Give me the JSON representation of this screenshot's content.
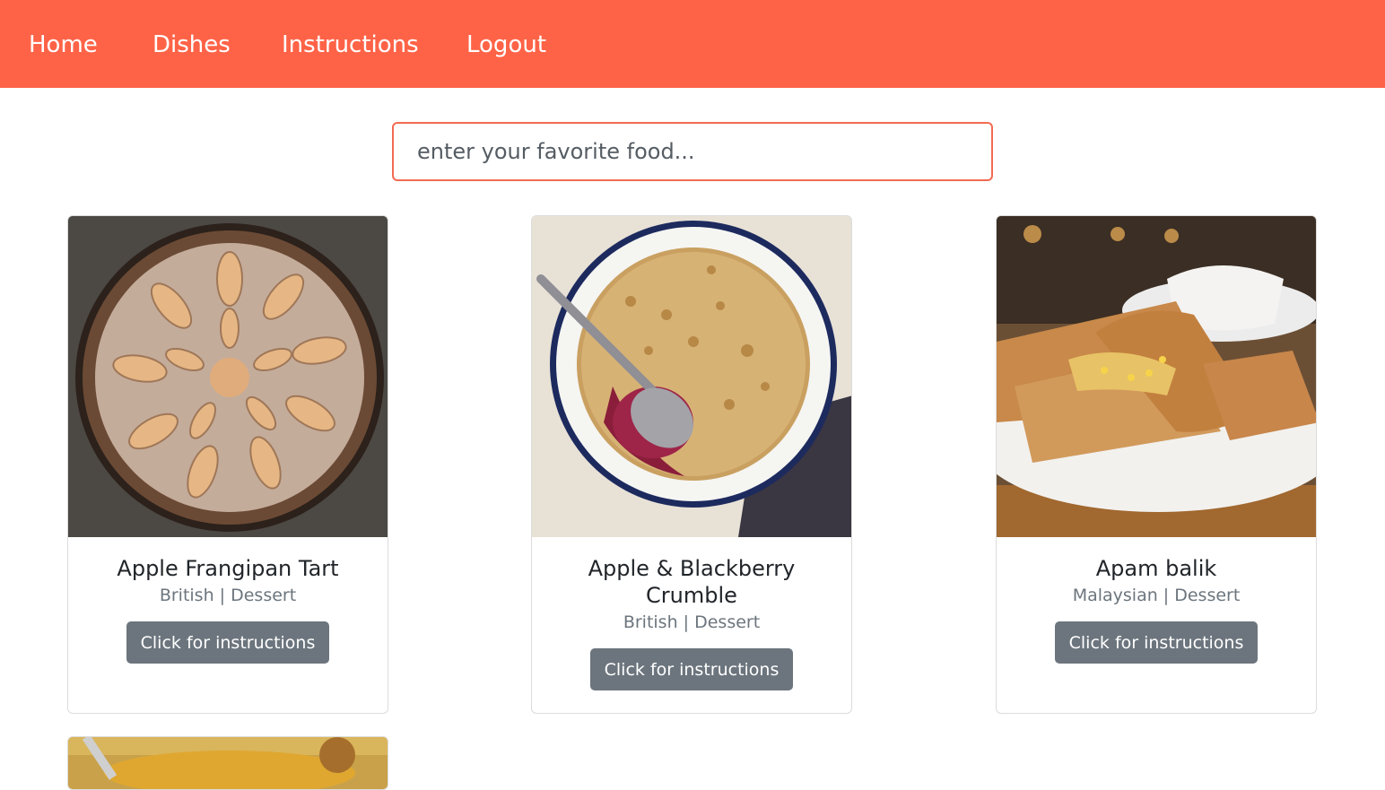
{
  "nav": {
    "items": [
      {
        "label": "Home"
      },
      {
        "label": "Dishes"
      },
      {
        "label": "Instructions"
      },
      {
        "label": "Logout"
      }
    ],
    "bg_color": "#ff6347"
  },
  "search": {
    "placeholder": "enter your favorite food...",
    "value": ""
  },
  "dishes": [
    {
      "name": "Apple Frangipan Tart",
      "meta": "British | Dessert",
      "button": "Click for instructions",
      "image": "apple-tart-photo"
    },
    {
      "name": "Apple & Blackberry Crumble",
      "meta": "British | Dessert",
      "button": "Click for instructions",
      "image": "crumble-photo"
    },
    {
      "name": "Apam balik",
      "meta": "Malaysian | Dessert",
      "button": "Click for instructions",
      "image": "apam-balik-photo"
    },
    {
      "image": "partial-dish-photo"
    }
  ],
  "colors": {
    "accent": "#ff6347",
    "button": "#6c757d",
    "meta_text": "#6c757d"
  }
}
